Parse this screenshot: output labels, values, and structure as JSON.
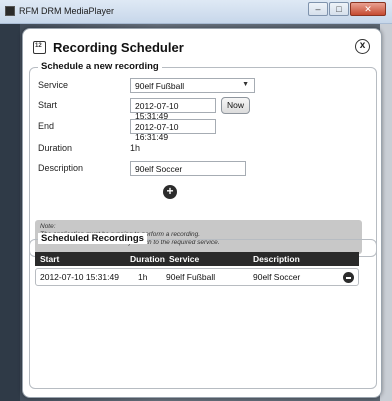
{
  "window": {
    "title": "RFM DRM MediaPlayer",
    "buttons": {
      "minimize": "–",
      "maximize": "□",
      "close": "✕"
    }
  },
  "dialog": {
    "title": "Recording Scheduler",
    "close_symbol": "x"
  },
  "new_recording": {
    "legend": "Schedule a new recording",
    "service_label": "Service",
    "service_value": "90elf Fußball",
    "start_label": "Start",
    "start_value": "2012-07-10 15:31:49",
    "now_button": "Now",
    "end_label": "End",
    "end_value": "2012-07-10 16:31:49",
    "duration_label": "Duration",
    "duration_value": "1h",
    "description_label": "Description",
    "description_value": "90elf Soccer",
    "add_symbol": "+"
  },
  "note": {
    "line1": "Note:",
    "line2": "The application must be running to perform a recording.",
    "line3": "The scheduler will automatically switch to the required service."
  },
  "scheduled": {
    "legend": "Scheduled Recordings",
    "columns": [
      "Start",
      "Duration",
      "Service",
      "Description"
    ],
    "rows": [
      {
        "start": "2012-07-10 15:31:49",
        "duration": "1h",
        "service": "90elf Fußball",
        "description": "90elf Soccer"
      }
    ]
  }
}
